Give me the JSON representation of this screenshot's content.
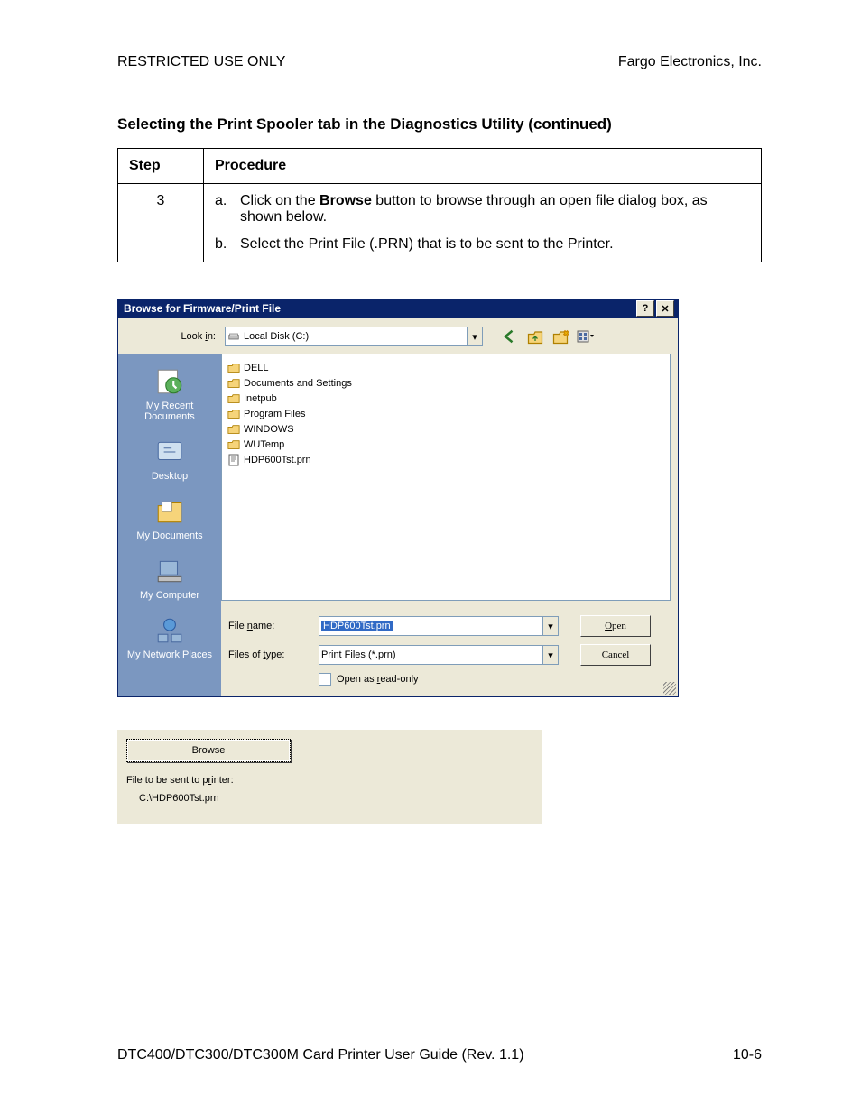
{
  "header": {
    "left": "RESTRICTED USE ONLY",
    "right": "Fargo Electronics, Inc."
  },
  "section_title": "Selecting the Print Spooler tab in the Diagnostics Utility (continued)",
  "table": {
    "headers": {
      "step": "Step",
      "procedure": "Procedure"
    },
    "step_number": "3",
    "items": [
      {
        "letter": "a.",
        "prefix": "Click on the ",
        "bold": "Browse",
        "suffix": " button to browse through an open file dialog box, as shown below."
      },
      {
        "letter": "b.",
        "prefix": "Select the Print File (.PRN) that is to be sent to the Printer.",
        "bold": "",
        "suffix": ""
      }
    ]
  },
  "dialog": {
    "title": "Browse for Firmware/Print File",
    "help_btn": "?",
    "close_btn": "✕",
    "lookin_label_pre": "Look ",
    "lookin_label_u": "i",
    "lookin_label_post": "n:",
    "lookin_value": "Local Disk (C:)",
    "places": [
      {
        "name": "my-recent-docs",
        "label": "My Recent Documents"
      },
      {
        "name": "desktop",
        "label": "Desktop"
      },
      {
        "name": "my-documents",
        "label": "My Documents"
      },
      {
        "name": "my-computer",
        "label": "My Computer"
      },
      {
        "name": "my-network",
        "label": "My Network Places"
      }
    ],
    "folders": [
      {
        "name": "DELL"
      },
      {
        "name": "Documents and Settings"
      },
      {
        "name": "Inetpub"
      },
      {
        "name": "Program Files"
      },
      {
        "name": "WINDOWS"
      },
      {
        "name": "WUTemp"
      }
    ],
    "files": [
      {
        "name": "HDP600Tst.prn"
      }
    ],
    "filename_label_pre": "File ",
    "filename_label_u": "n",
    "filename_label_post": "ame:",
    "filename_value": "HDP600Tst.prn",
    "filetype_label_pre": "Files of ",
    "filetype_label_u": "t",
    "filetype_label_post": "ype:",
    "filetype_value": "Print Files (*.prn)",
    "readonly_pre": "Open as ",
    "readonly_u": "r",
    "readonly_post": "ead-only",
    "open_u": "O",
    "open_rest": "pen",
    "cancel": "Cancel"
  },
  "panel2": {
    "browse": "Browse",
    "label_pre": "File to be sent to p",
    "label_u": "r",
    "label_post": "inter:",
    "path": "C:\\HDP600Tst.prn"
  },
  "footer": {
    "left": "DTC400/DTC300/DTC300M Card Printer User Guide (Rev. 1.1)",
    "right": "10-6"
  }
}
